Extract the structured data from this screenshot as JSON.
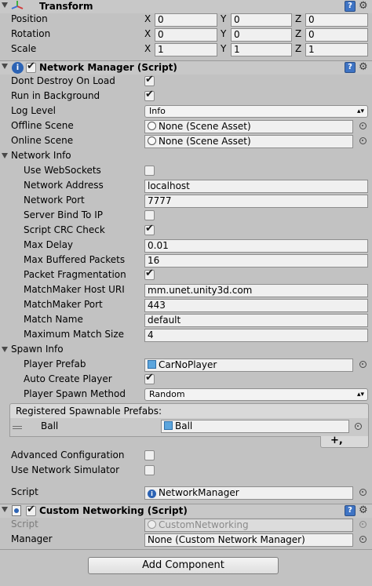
{
  "transform": {
    "title": "Transform",
    "rows": [
      {
        "label": "Position",
        "x": "0",
        "y": "0",
        "z": "0"
      },
      {
        "label": "Rotation",
        "x": "0",
        "y": "0",
        "z": "0"
      },
      {
        "label": "Scale",
        "x": "1",
        "y": "1",
        "z": "1"
      }
    ],
    "axis_x": "X",
    "axis_y": "Y",
    "axis_z": "Z"
  },
  "network_manager": {
    "title": "Network Manager (Script)",
    "dont_destroy_label": "Dont Destroy On Load",
    "dont_destroy_checked": true,
    "run_bg_label": "Run in Background",
    "run_bg_checked": true,
    "log_level_label": "Log Level",
    "log_level_value": "Info",
    "offline_scene_label": "Offline Scene",
    "offline_scene_value": "None (Scene Asset)",
    "online_scene_label": "Online Scene",
    "online_scene_value": "None (Scene Asset)",
    "network_info_label": "Network Info",
    "use_websockets_label": "Use WebSockets",
    "use_websockets_checked": false,
    "network_address_label": "Network Address",
    "network_address_value": "localhost",
    "network_port_label": "Network Port",
    "network_port_value": "7777",
    "server_bind_label": "Server Bind To IP",
    "server_bind_checked": false,
    "script_crc_label": "Script CRC Check",
    "script_crc_checked": true,
    "max_delay_label": "Max Delay",
    "max_delay_value": "0.01",
    "max_buffered_label": "Max Buffered Packets",
    "max_buffered_value": "16",
    "packet_frag_label": "Packet Fragmentation",
    "packet_frag_checked": true,
    "mm_host_label": "MatchMaker Host URI",
    "mm_host_value": "mm.unet.unity3d.com",
    "mm_port_label": "MatchMaker Port",
    "mm_port_value": "443",
    "match_name_label": "Match Name",
    "match_name_value": "default",
    "max_match_label": "Maximum Match Size",
    "max_match_value": "4",
    "spawn_info_label": "Spawn Info",
    "player_prefab_label": "Player Prefab",
    "player_prefab_value": "CarNoPlayer",
    "auto_create_label": "Auto Create Player",
    "auto_create_checked": true,
    "spawn_method_label": "Player Spawn Method",
    "spawn_method_value": "Random",
    "registered_prefabs_label": "Registered Spawnable Prefabs:",
    "registered_item_name": "Ball",
    "registered_item_value": "Ball",
    "add_glyph": "+,",
    "advanced_config_label": "Advanced Configuration",
    "advanced_config_checked": false,
    "use_net_sim_label": "Use Network Simulator",
    "use_net_sim_checked": false,
    "script_label": "Script",
    "script_value": "NetworkManager",
    "script_icon_glyph": "i"
  },
  "custom_networking": {
    "title": "Custom Networking (Script)",
    "enabled": true,
    "script_label": "Script",
    "script_value": "CustomNetworking",
    "manager_label": "Manager",
    "manager_value": "None (Custom Network Manager)"
  },
  "add_component_label": "Add Component",
  "help_glyph": "?",
  "gear_glyph": "⚙",
  "dropdown_arrow": "▴▾"
}
